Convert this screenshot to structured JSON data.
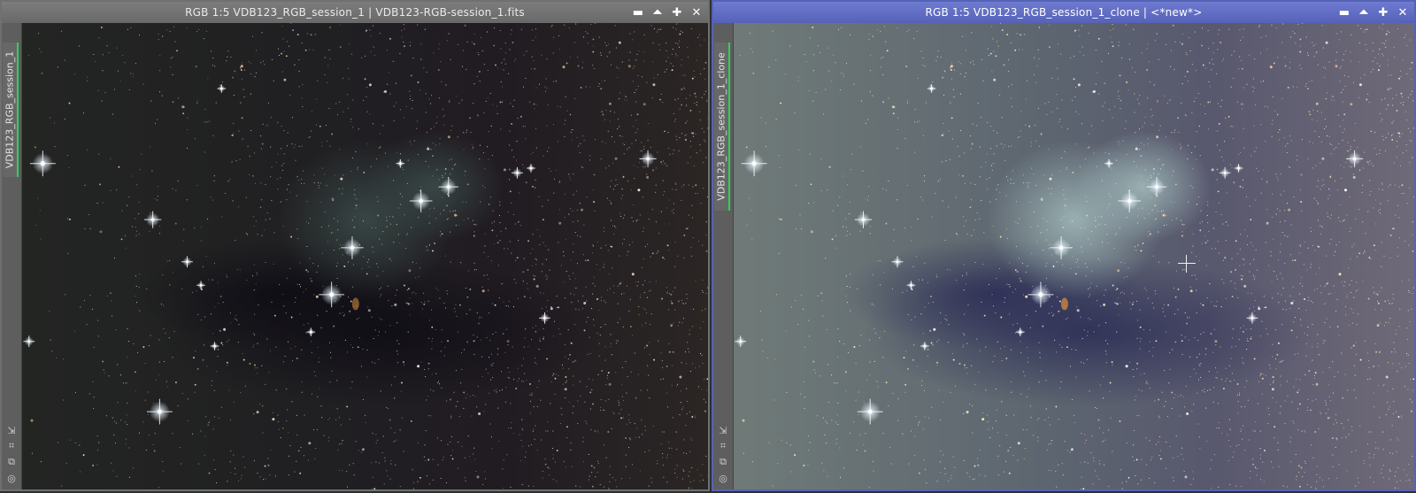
{
  "windows": [
    {
      "id": "original",
      "title": "RGB 1:5 VDB123_RGB_session_1 | VDB123-RGB-session_1.fits",
      "side_label": "VDB123_RGB_session_1",
      "active": false
    },
    {
      "id": "clone",
      "title": "RGB 1:5 VDB123_RGB_session_1_clone | <*new*>",
      "side_label": "VDB123_RGB_session_1_clone",
      "active": true
    }
  ],
  "title_buttons": {
    "minimize": "▬",
    "shade": "⏶",
    "maximize": "✚",
    "close": "✕"
  },
  "side_icons": {
    "fit": "⇲",
    "zoom": "⌗",
    "lock": "⧉",
    "settings": "◎"
  },
  "colors": {
    "inactive_title": "#6e6e6e",
    "active_title": "#5a66bc",
    "tab_accent": "#2bd15b"
  }
}
